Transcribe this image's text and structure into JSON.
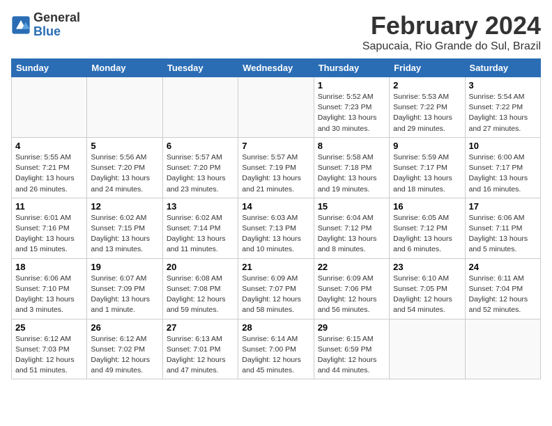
{
  "header": {
    "logo_general": "General",
    "logo_blue": "Blue",
    "month_year": "February 2024",
    "location": "Sapucaia, Rio Grande do Sul, Brazil"
  },
  "weekdays": [
    "Sunday",
    "Monday",
    "Tuesday",
    "Wednesday",
    "Thursday",
    "Friday",
    "Saturday"
  ],
  "weeks": [
    [
      {
        "day": "",
        "info": ""
      },
      {
        "day": "",
        "info": ""
      },
      {
        "day": "",
        "info": ""
      },
      {
        "day": "",
        "info": ""
      },
      {
        "day": "1",
        "info": "Sunrise: 5:52 AM\nSunset: 7:23 PM\nDaylight: 13 hours\nand 30 minutes."
      },
      {
        "day": "2",
        "info": "Sunrise: 5:53 AM\nSunset: 7:22 PM\nDaylight: 13 hours\nand 29 minutes."
      },
      {
        "day": "3",
        "info": "Sunrise: 5:54 AM\nSunset: 7:22 PM\nDaylight: 13 hours\nand 27 minutes."
      }
    ],
    [
      {
        "day": "4",
        "info": "Sunrise: 5:55 AM\nSunset: 7:21 PM\nDaylight: 13 hours\nand 26 minutes."
      },
      {
        "day": "5",
        "info": "Sunrise: 5:56 AM\nSunset: 7:20 PM\nDaylight: 13 hours\nand 24 minutes."
      },
      {
        "day": "6",
        "info": "Sunrise: 5:57 AM\nSunset: 7:20 PM\nDaylight: 13 hours\nand 23 minutes."
      },
      {
        "day": "7",
        "info": "Sunrise: 5:57 AM\nSunset: 7:19 PM\nDaylight: 13 hours\nand 21 minutes."
      },
      {
        "day": "8",
        "info": "Sunrise: 5:58 AM\nSunset: 7:18 PM\nDaylight: 13 hours\nand 19 minutes."
      },
      {
        "day": "9",
        "info": "Sunrise: 5:59 AM\nSunset: 7:17 PM\nDaylight: 13 hours\nand 18 minutes."
      },
      {
        "day": "10",
        "info": "Sunrise: 6:00 AM\nSunset: 7:17 PM\nDaylight: 13 hours\nand 16 minutes."
      }
    ],
    [
      {
        "day": "11",
        "info": "Sunrise: 6:01 AM\nSunset: 7:16 PM\nDaylight: 13 hours\nand 15 minutes."
      },
      {
        "day": "12",
        "info": "Sunrise: 6:02 AM\nSunset: 7:15 PM\nDaylight: 13 hours\nand 13 minutes."
      },
      {
        "day": "13",
        "info": "Sunrise: 6:02 AM\nSunset: 7:14 PM\nDaylight: 13 hours\nand 11 minutes."
      },
      {
        "day": "14",
        "info": "Sunrise: 6:03 AM\nSunset: 7:13 PM\nDaylight: 13 hours\nand 10 minutes."
      },
      {
        "day": "15",
        "info": "Sunrise: 6:04 AM\nSunset: 7:12 PM\nDaylight: 13 hours\nand 8 minutes."
      },
      {
        "day": "16",
        "info": "Sunrise: 6:05 AM\nSunset: 7:12 PM\nDaylight: 13 hours\nand 6 minutes."
      },
      {
        "day": "17",
        "info": "Sunrise: 6:06 AM\nSunset: 7:11 PM\nDaylight: 13 hours\nand 5 minutes."
      }
    ],
    [
      {
        "day": "18",
        "info": "Sunrise: 6:06 AM\nSunset: 7:10 PM\nDaylight: 13 hours\nand 3 minutes."
      },
      {
        "day": "19",
        "info": "Sunrise: 6:07 AM\nSunset: 7:09 PM\nDaylight: 13 hours\nand 1 minute."
      },
      {
        "day": "20",
        "info": "Sunrise: 6:08 AM\nSunset: 7:08 PM\nDaylight: 12 hours\nand 59 minutes."
      },
      {
        "day": "21",
        "info": "Sunrise: 6:09 AM\nSunset: 7:07 PM\nDaylight: 12 hours\nand 58 minutes."
      },
      {
        "day": "22",
        "info": "Sunrise: 6:09 AM\nSunset: 7:06 PM\nDaylight: 12 hours\nand 56 minutes."
      },
      {
        "day": "23",
        "info": "Sunrise: 6:10 AM\nSunset: 7:05 PM\nDaylight: 12 hours\nand 54 minutes."
      },
      {
        "day": "24",
        "info": "Sunrise: 6:11 AM\nSunset: 7:04 PM\nDaylight: 12 hours\nand 52 minutes."
      }
    ],
    [
      {
        "day": "25",
        "info": "Sunrise: 6:12 AM\nSunset: 7:03 PM\nDaylight: 12 hours\nand 51 minutes."
      },
      {
        "day": "26",
        "info": "Sunrise: 6:12 AM\nSunset: 7:02 PM\nDaylight: 12 hours\nand 49 minutes."
      },
      {
        "day": "27",
        "info": "Sunrise: 6:13 AM\nSunset: 7:01 PM\nDaylight: 12 hours\nand 47 minutes."
      },
      {
        "day": "28",
        "info": "Sunrise: 6:14 AM\nSunset: 7:00 PM\nDaylight: 12 hours\nand 45 minutes."
      },
      {
        "day": "29",
        "info": "Sunrise: 6:15 AM\nSunset: 6:59 PM\nDaylight: 12 hours\nand 44 minutes."
      },
      {
        "day": "",
        "info": ""
      },
      {
        "day": "",
        "info": ""
      }
    ]
  ]
}
